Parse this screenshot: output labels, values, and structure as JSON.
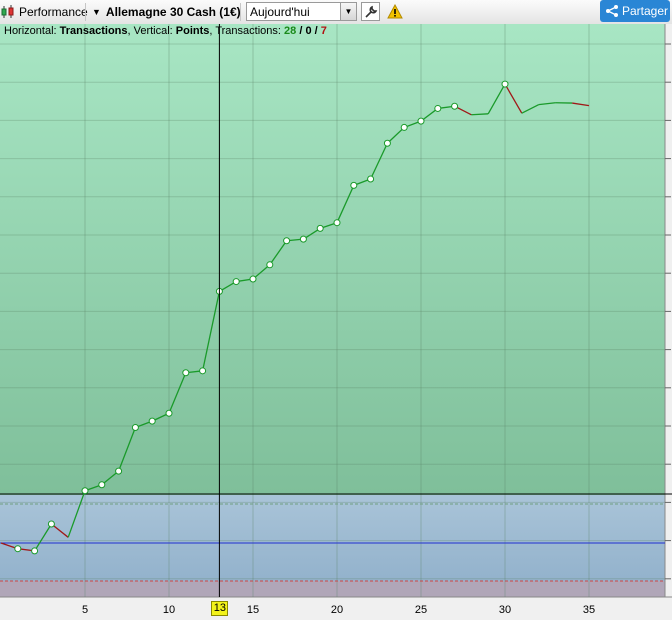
{
  "toolbar": {
    "performance_label": "Performance",
    "instrument_label": "Allemagne 30 Cash (1€)",
    "period_value": "Aujourd'hui",
    "share_label": "Partager"
  },
  "info": {
    "horizontal_prefix": "Horizontal: ",
    "horizontal_value": "Transactions",
    "vertical_prefix": ", Vertical: ",
    "vertical_value": "Points",
    "transactions_prefix": ", Transactions: ",
    "wins": "28",
    "sep1": " / ",
    "neutral": "0",
    "sep2": " / ",
    "losses": "7"
  },
  "colors": {
    "win": "#1a9a2a",
    "loss": "#a01818",
    "zero_line": "#1f2fd0",
    "cursor": "#000000"
  },
  "x_axis": {
    "ticks": [
      "5",
      "10",
      "15",
      "20",
      "25",
      "30",
      "35"
    ],
    "cursor_label": "13"
  },
  "chart_data": {
    "type": "line",
    "x": [
      0,
      1,
      2,
      3,
      4,
      5,
      6,
      7,
      8,
      9,
      10,
      11,
      12,
      13,
      14,
      15,
      16,
      17,
      18,
      19,
      20,
      21,
      22,
      23,
      24,
      25,
      26,
      27,
      28,
      29,
      30,
      31,
      32,
      33,
      34,
      35
    ],
    "y": [
      0,
      -0.18,
      -0.25,
      0.6,
      0.18,
      1.65,
      1.84,
      2.27,
      3.65,
      3.85,
      4.1,
      5.38,
      5.44,
      7.95,
      8.26,
      8.34,
      8.79,
      9.55,
      9.6,
      9.94,
      10.12,
      11.3,
      11.5,
      12.63,
      13.13,
      13.33,
      13.73,
      13.8,
      13.53,
      13.56,
      14.5,
      13.58,
      13.85,
      13.91,
      13.9,
      13.82
    ],
    "marked_points": [
      1,
      2,
      3,
      5,
      6,
      7,
      8,
      9,
      10,
      11,
      12,
      13,
      14,
      15,
      16,
      17,
      18,
      19,
      20,
      21,
      22,
      23,
      24,
      25,
      26,
      27,
      30
    ],
    "losing_segments": [
      [
        0,
        1
      ],
      [
        1,
        2
      ],
      [
        3,
        4
      ],
      [
        27,
        28
      ],
      [
        30,
        31
      ],
      [
        34,
        35
      ]
    ],
    "xlim": [
      0,
      39
    ],
    "cursor_x": 13
  }
}
